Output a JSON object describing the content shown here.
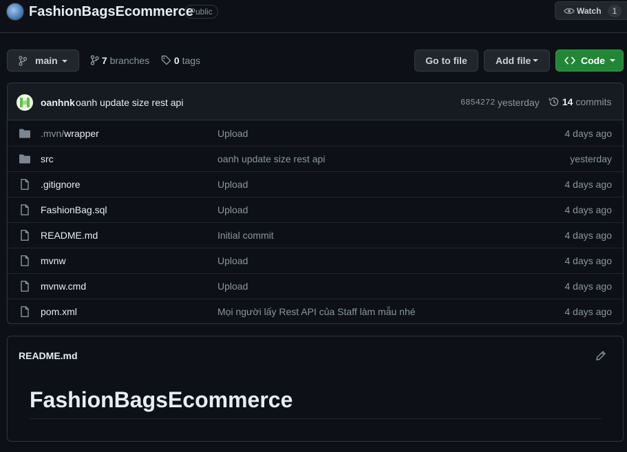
{
  "repo": {
    "name": "FashionBagsEcommerce",
    "visibility": "Public"
  },
  "watch": {
    "label": "Watch",
    "count": "1"
  },
  "toolbar": {
    "branch": "main",
    "branches_count": "7",
    "branches_label": "branches",
    "tags_count": "0",
    "tags_label": "tags",
    "go_to_file": "Go to file",
    "add_file": "Add file",
    "code": "Code"
  },
  "latest_commit": {
    "author": "oanhnk",
    "message": "oanh update size rest api",
    "hash": "6854272",
    "time": "yesterday",
    "commits_count": "14",
    "commits_label": "commits"
  },
  "files": [
    {
      "type": "folder",
      "name_prefix": ".mvn/",
      "name": "wrapper",
      "message": "Upload",
      "age": "4 days ago"
    },
    {
      "type": "folder",
      "name_prefix": "",
      "name": "src",
      "message": "oanh update size rest api",
      "age": "yesterday"
    },
    {
      "type": "file",
      "name_prefix": "",
      "name": ".gitignore",
      "message": "Upload",
      "age": "4 days ago"
    },
    {
      "type": "file",
      "name_prefix": "",
      "name": "FashionBag.sql",
      "message": "Upload",
      "age": "4 days ago"
    },
    {
      "type": "file",
      "name_prefix": "",
      "name": "README.md",
      "message": "Initial commit",
      "age": "4 days ago"
    },
    {
      "type": "file",
      "name_prefix": "",
      "name": "mvnw",
      "message": "Upload",
      "age": "4 days ago"
    },
    {
      "type": "file",
      "name_prefix": "",
      "name": "mvnw.cmd",
      "message": "Upload",
      "age": "4 days ago"
    },
    {
      "type": "file",
      "name_prefix": "",
      "name": "pom.xml",
      "message": "Mọi người lấy Rest API của Staff làm mẫu nhé",
      "age": "4 days ago"
    }
  ],
  "readme": {
    "filename": "README.md",
    "heading": "FashionBagsEcommerce"
  },
  "colors": {
    "background": "#0d1117",
    "border": "#30363d",
    "code_button": "#238636",
    "folder_icon": "#7d8590"
  }
}
